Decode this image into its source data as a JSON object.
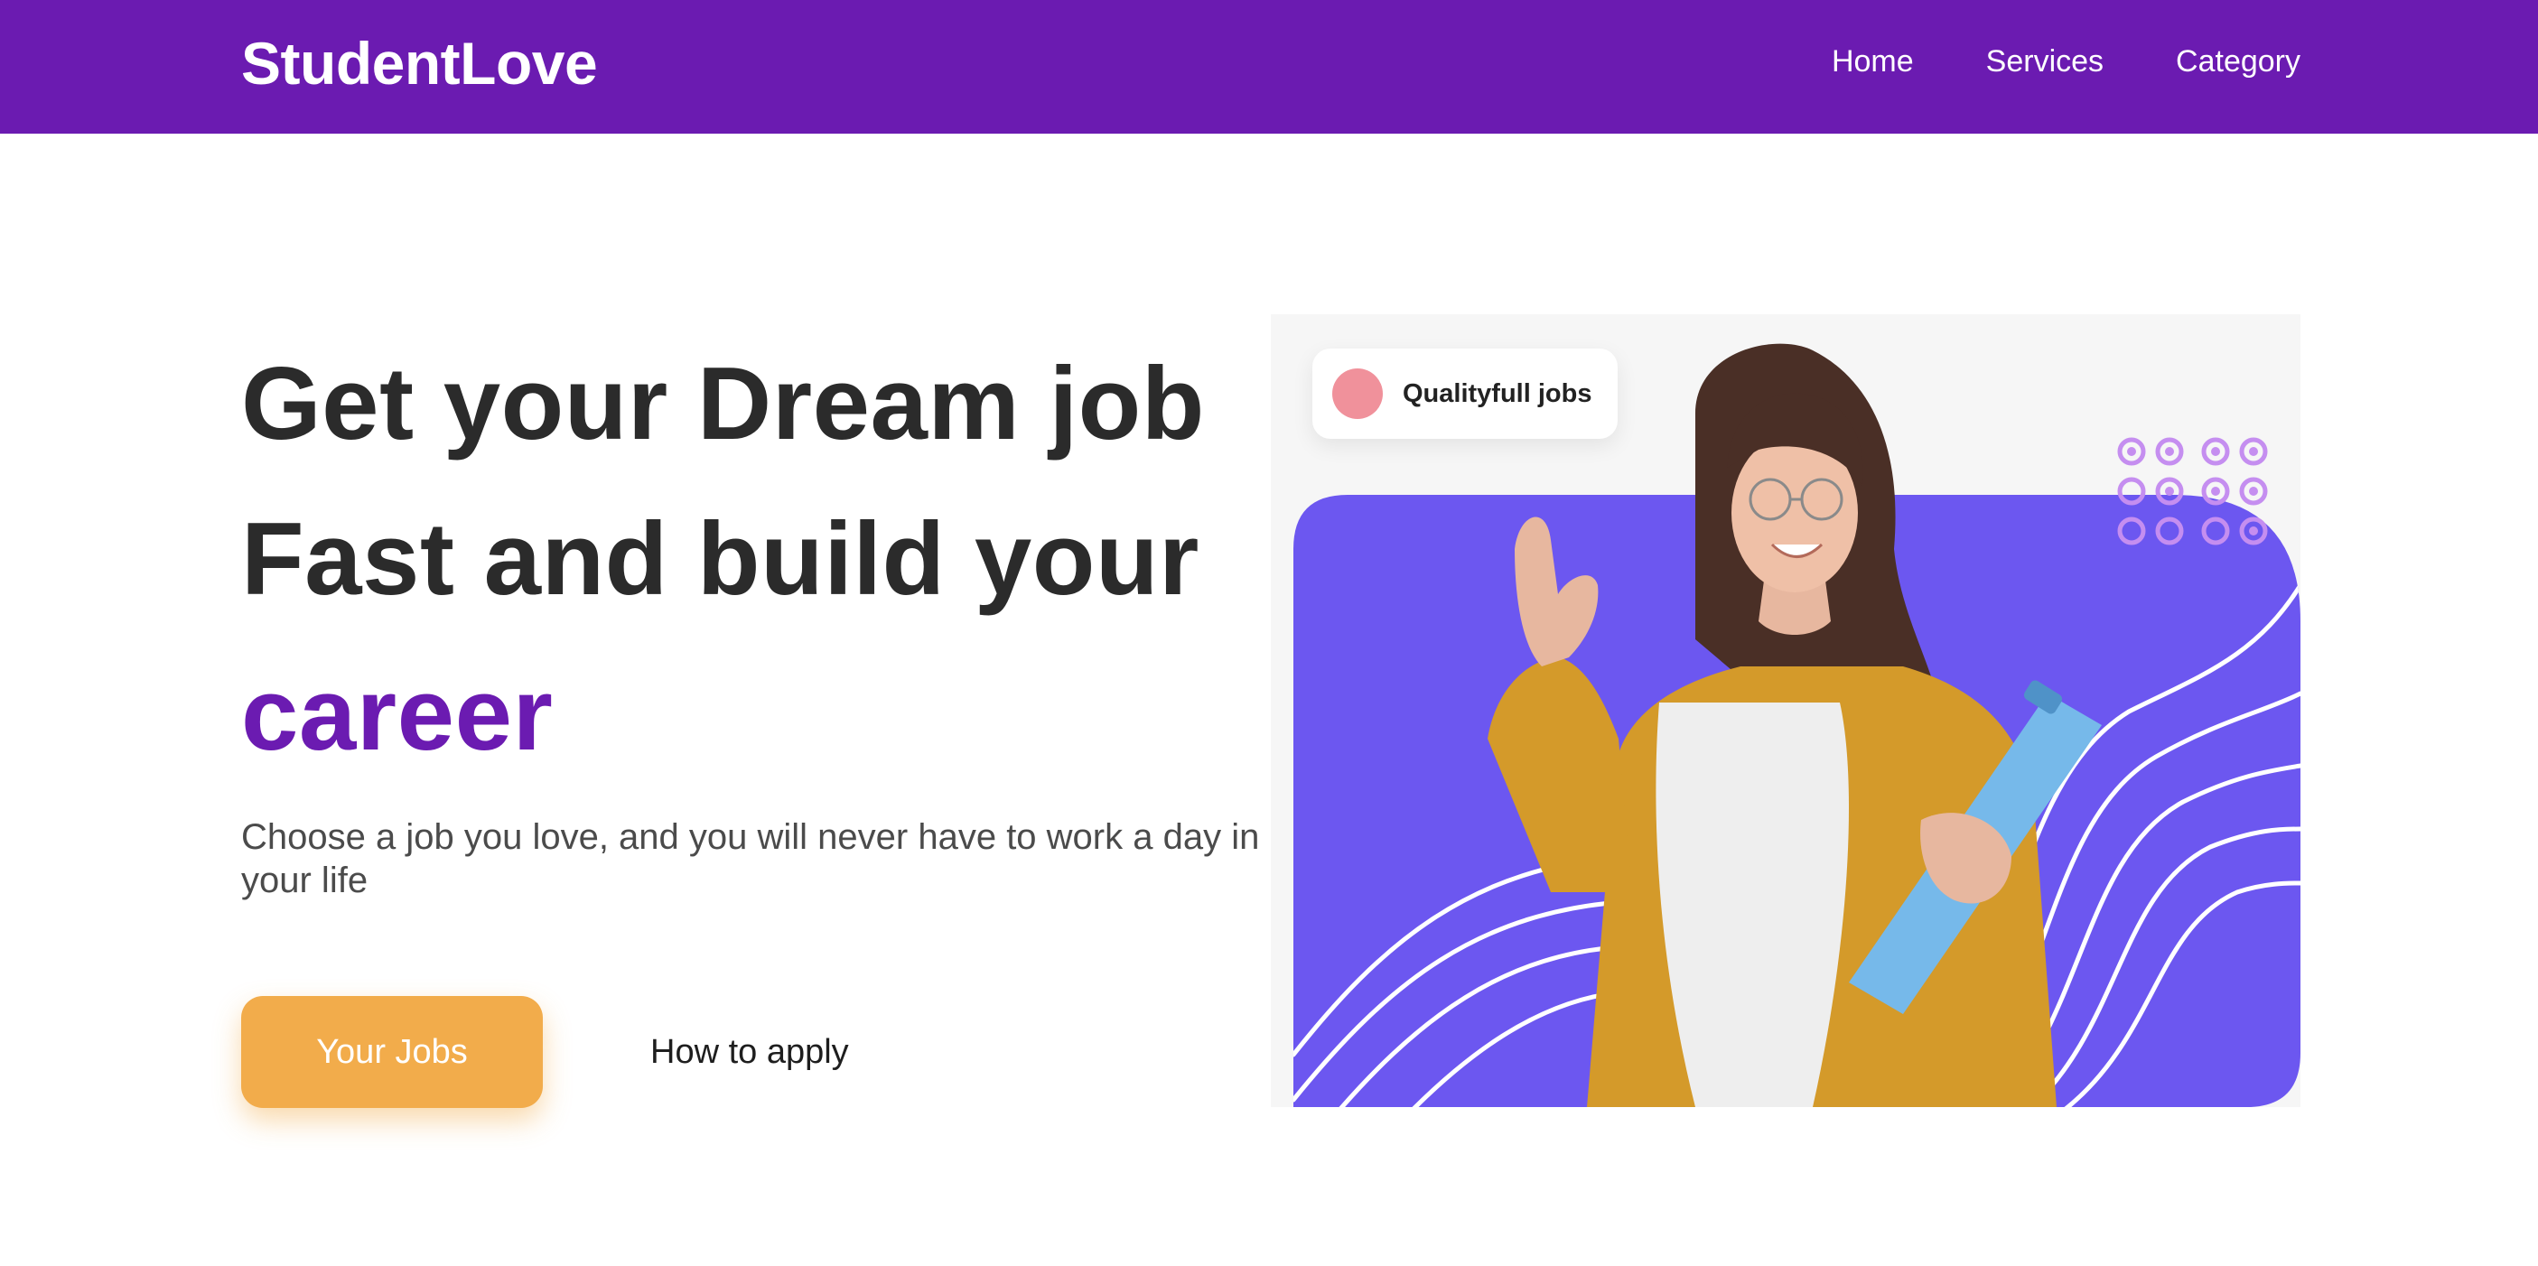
{
  "navbar": {
    "brand": "StudentLove",
    "links": [
      "Home",
      "Services",
      "Category"
    ],
    "background": "#6b1bb1"
  },
  "hero": {
    "title_lines": [
      "Get your Dream job",
      "Fast and build your"
    ],
    "title_accent": "career",
    "subtitle": "Choose a job you love, and you will never have to work a day in your life",
    "primary_button": "Your Jobs",
    "secondary_link": "How to apply",
    "accent_color": "#6b1bb1",
    "button_color": "#f2ac4b"
  },
  "visual": {
    "badge_text": "Qualityfull jobs",
    "badge_dot_color": "#f0919b",
    "card_color": "#6c57f0",
    "icons": [
      "dot-grid-icon",
      "wavy-lines-icon"
    ],
    "photo": "smiling woman in mustard jacket holding blue clipboard, pointing up"
  }
}
